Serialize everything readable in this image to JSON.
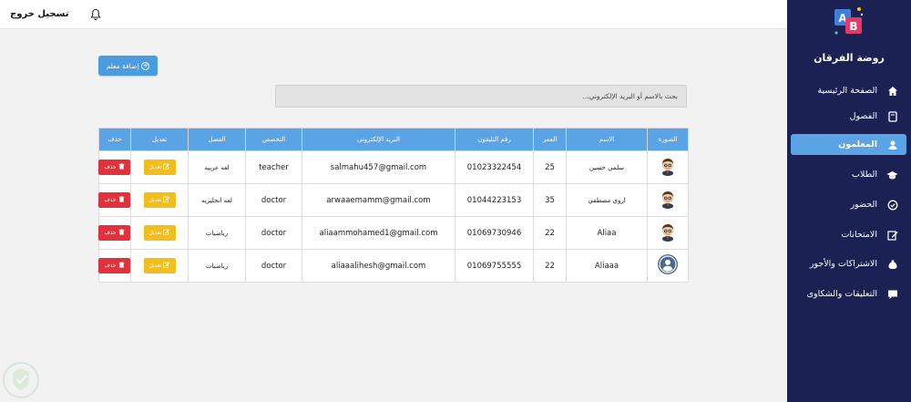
{
  "topbar": {
    "logout_label": "تسجيل خروج",
    "bell_icon": "bell-icon"
  },
  "sidebar": {
    "brand": "روضة الفرقان",
    "logo_text": "AB",
    "items": [
      {
        "label": "الصفحة الرئيسية",
        "icon": "home-icon"
      },
      {
        "label": "الفصول",
        "icon": "book-icon"
      },
      {
        "label": "المعلمون",
        "icon": "user-icon",
        "active": true
      },
      {
        "label": "الطلاب",
        "icon": "graduation-cap-icon"
      },
      {
        "label": "الحضور",
        "icon": "check-circle-icon"
      },
      {
        "label": "الامتحانات",
        "icon": "edit-icon"
      },
      {
        "label": "الاشتراكات والأجور",
        "icon": "money-bag-icon"
      },
      {
        "label": "التعليقات والشكاوى",
        "icon": "comment-icon"
      }
    ]
  },
  "toolbar": {
    "add_teacher_label": "إضافة معلم"
  },
  "search": {
    "placeholder": "بحث بالاسم أو البريد الإلكتروني..."
  },
  "table": {
    "headers": [
      "الصورة",
      "الاسم",
      "العمر",
      "رقم التليفون",
      "البريد الإلكتروني",
      "التخصص",
      "الفصل",
      "تعديل",
      "حذف"
    ],
    "edit_label": "تعديل",
    "delete_label": "حذف",
    "rows": [
      {
        "name": "سلمي حسين",
        "age": "25",
        "phone": "01023322454",
        "email": "salmahu457@gmail.com",
        "specialty": "teacher",
        "class": "لغه عربيه",
        "avatar": "cartoon"
      },
      {
        "name": "اروي مصطفي",
        "age": "35",
        "phone": "01044223153",
        "email": "arwaaemamm@gmail.com",
        "specialty": "doctor",
        "class": "لغه انجليزيه",
        "avatar": "cartoon"
      },
      {
        "name": "Aliaa",
        "age": "22",
        "phone": "01069730946",
        "email": "aliaammohamed1@gmail.com",
        "specialty": "doctor",
        "class": "رياضيات",
        "avatar": "cartoon"
      },
      {
        "name": "Aliaaa",
        "age": "22",
        "phone": "01069755555",
        "email": "aliaaalihesh@gmail.com",
        "specialty": "doctor",
        "class": "رياضيات",
        "avatar": "default"
      }
    ]
  },
  "colors": {
    "sidebar_bg": "#1b2153",
    "accent": "#5aa4e6",
    "delete": "#e0323d",
    "edit": "#f3bd1b"
  }
}
